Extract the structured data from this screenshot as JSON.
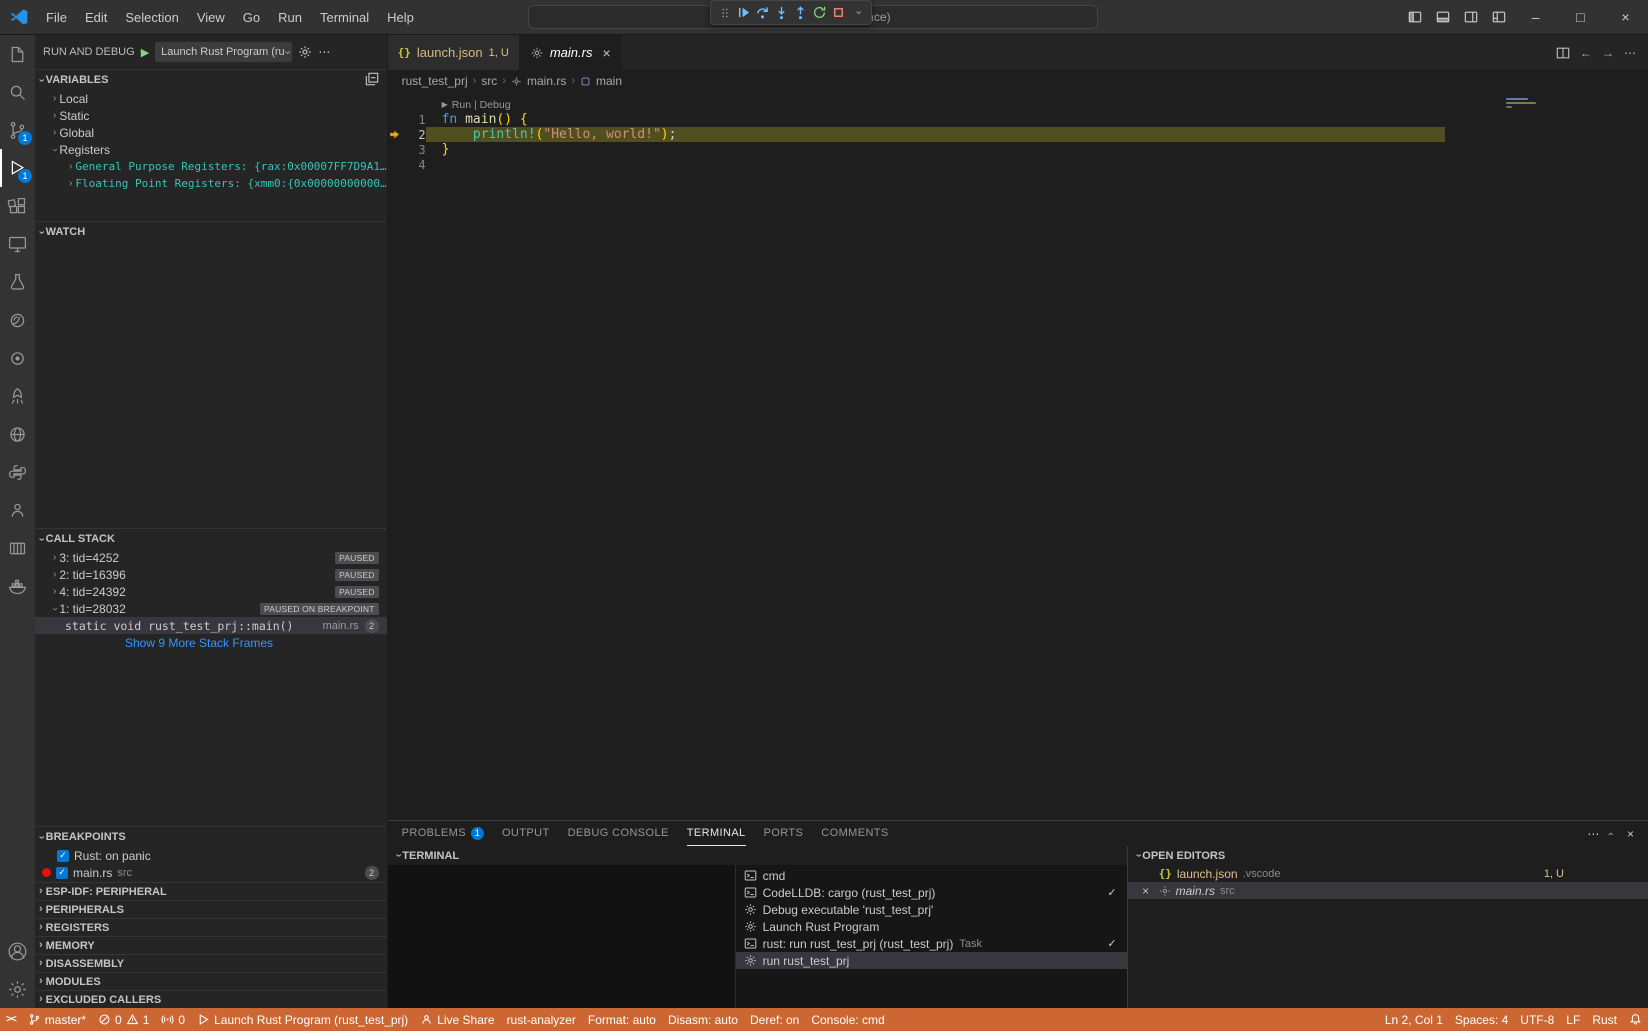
{
  "titlebar": {
    "menus": [
      "File",
      "Edit",
      "Selection",
      "View",
      "Go",
      "Run",
      "Terminal",
      "Help"
    ],
    "command_center": "rust_workspace (Workspace)"
  },
  "debug_toolbar": {
    "icons": [
      "gripper",
      "debug-continue",
      "debug-step-over",
      "debug-step-into",
      "debug-step-out",
      "debug-restart",
      "debug-stop",
      "chevron-down"
    ]
  },
  "activity_bar": {
    "items": [
      "explorer",
      "search",
      "source-control",
      "run-and-debug",
      "extensions",
      "remote-explorer",
      "testing",
      "espressif",
      "wokwi",
      "rocket",
      "globe",
      "python",
      "live-share",
      "container",
      "docker"
    ],
    "badges": {
      "source_control": "1",
      "run_and_debug": "1"
    },
    "bottom": [
      "accounts",
      "settings"
    ]
  },
  "sidebar": {
    "title": "RUN AND DEBUG",
    "launch_config": "Launch Rust Program (ru",
    "variables": {
      "title": "VARIABLES",
      "scopes": [
        "Local",
        "Static",
        "Global",
        "Registers"
      ],
      "registers": [
        "General Purpose Registers: {rax:0x00007FF7D9A1…",
        "Floating Point Registers: {xmm0:{0x00000000000…"
      ]
    },
    "watch": {
      "title": "WATCH"
    },
    "call_stack": {
      "title": "CALL STACK",
      "threads": [
        {
          "label": "3: tid=4252",
          "status": "PAUSED"
        },
        {
          "label": "2: tid=16396",
          "status": "PAUSED"
        },
        {
          "label": "4: tid=24392",
          "status": "PAUSED"
        },
        {
          "label": "1: tid=28032",
          "status": "PAUSED ON BREAKPOINT"
        }
      ],
      "frame": {
        "name": "static void rust_test_prj::main()",
        "file": "main.rs",
        "line": "2"
      },
      "show_more": "Show 9 More Stack Frames"
    },
    "breakpoints": {
      "title": "BREAKPOINTS",
      "items": [
        {
          "label": "Rust: on panic"
        },
        {
          "label": "main.rs",
          "path": "src",
          "line": "2"
        }
      ]
    },
    "sections": [
      "ESP-IDF: PERIPHERAL",
      "PERIPHERALS",
      "REGISTERS",
      "MEMORY",
      "DISASSEMBLY",
      "MODULES",
      "EXCLUDED CALLERS"
    ]
  },
  "editor": {
    "tabs": [
      {
        "label": "launch.json",
        "decoration": "1, U"
      },
      {
        "label": "main.rs"
      }
    ],
    "breadcrumbs": [
      "rust_test_prj",
      "src",
      "main.rs",
      "main"
    ],
    "codelens": "Run | Debug",
    "code": {
      "l1": {
        "n": "1",
        "kw": "fn ",
        "fn": "main",
        "rest": "() {"
      },
      "l2": {
        "n": "2",
        "indent": "    ",
        "macro": "println!",
        "p1": "(",
        "str": "\"Hello, world!\"",
        "p2": ")",
        "semi": ";"
      },
      "l3": {
        "n": "3",
        "brace": "}"
      },
      "l4": {
        "n": "4"
      }
    }
  },
  "panel": {
    "tabs": [
      {
        "label": "PROBLEMS",
        "badge": "1"
      },
      {
        "label": "OUTPUT"
      },
      {
        "label": "DEBUG CONSOLE"
      },
      {
        "label": "TERMINAL"
      },
      {
        "label": "PORTS"
      },
      {
        "label": "COMMENTS"
      }
    ],
    "terminal": {
      "title": "TERMINAL",
      "list": [
        {
          "label": "cmd"
        },
        {
          "label": "CodeLLDB: cargo (rust_test_prj)",
          "checked": "✓"
        },
        {
          "label": "Debug executable 'rust_test_prj'"
        },
        {
          "label": "Launch Rust Program"
        },
        {
          "label": "rust: run rust_test_prj (rust_test_prj)",
          "suffix": "Task",
          "checked": "✓"
        },
        {
          "label": "run rust_test_prj"
        }
      ]
    },
    "open_editors": {
      "title": "OPEN EDITORS",
      "items": [
        {
          "label": "launch.json",
          "path": ".vscode",
          "decoration": "1, U"
        },
        {
          "label": "main.rs",
          "path": "src"
        }
      ]
    }
  },
  "status_bar": {
    "branch": "master*",
    "errors": "0",
    "warnings": "1",
    "ports": "0",
    "debug_config": "Launch Rust Program (rust_test_prj)",
    "live_share": "Live Share",
    "analyzer": "rust-analyzer",
    "format": "Format: auto",
    "disasm": "Disasm: auto",
    "deref": "Deref: on",
    "console": "Console: cmd",
    "line_col": "Ln 2, Col 1",
    "spaces": "Spaces: 4",
    "encoding": "UTF-8",
    "eol": "LF",
    "language": "Rust"
  },
  "colors": {
    "status_debugging": "#cc6633",
    "accent": "#0078d4",
    "debug_line_highlight": "#514e20",
    "modified_file": "#e2c08d"
  }
}
